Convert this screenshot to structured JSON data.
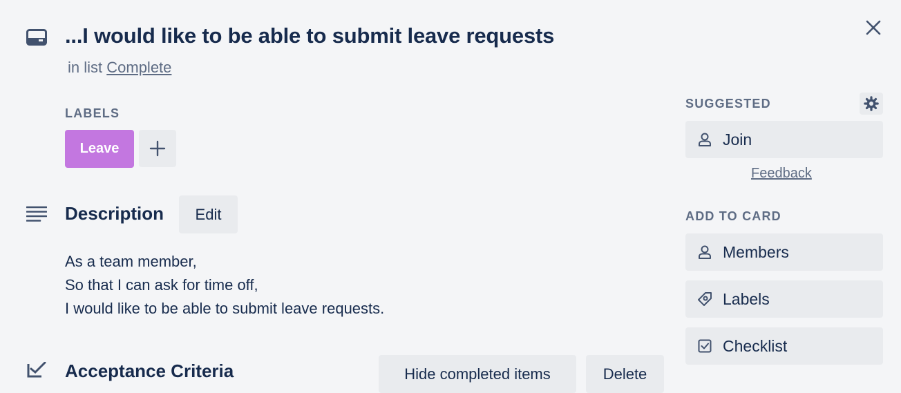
{
  "card": {
    "title": "...I would like to be able to submit leave requests",
    "in_list_prefix": "in list",
    "list_name": "Complete"
  },
  "labels": {
    "heading": "LABELS",
    "items": [
      {
        "text": "Leave",
        "color": "#c377e0"
      }
    ]
  },
  "description": {
    "heading": "Description",
    "edit_label": "Edit",
    "lines": [
      "As a team member,",
      "So that I can ask for time off,",
      "I would like to be able to submit leave requests."
    ]
  },
  "acceptance": {
    "heading": "Acceptance Criteria",
    "hide_label": "Hide completed items",
    "delete_label": "Delete"
  },
  "sidebar": {
    "suggested_heading": "SUGGESTED",
    "join_label": "Join",
    "feedback_label": "Feedback",
    "add_heading": "ADD TO CARD",
    "members_label": "Members",
    "labels_label": "Labels",
    "checklist_label": "Checklist"
  },
  "icons": {
    "card": "card-icon",
    "close": "close-icon",
    "add": "plus-icon",
    "description": "description-icon",
    "acceptance": "checklist-icon",
    "settings": "gear-icon",
    "person": "person-icon",
    "tag": "tag-icon",
    "checkbox": "checkbox-icon"
  },
  "colors": {
    "background": "#f4f5f7",
    "text": "#172b4d",
    "muted": "#5e6c84",
    "button": "#e9ebee",
    "label_leave": "#c377e0"
  }
}
